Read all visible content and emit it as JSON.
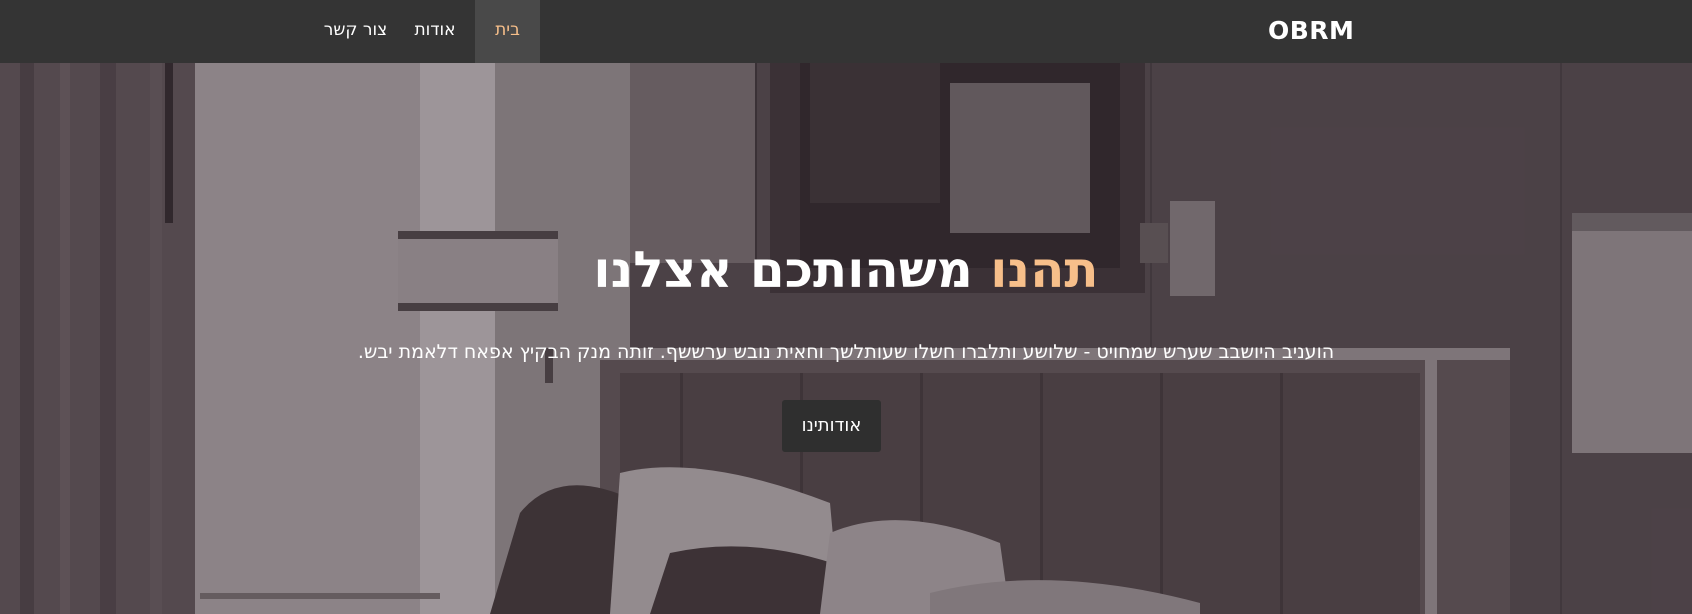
{
  "navbar": {
    "brand": "OBRM",
    "items": [
      {
        "label": "בית",
        "active": true
      },
      {
        "label": "אודות",
        "active": false
      },
      {
        "label": "צור קשר",
        "active": false
      }
    ]
  },
  "hero": {
    "title_accent": "תהנו",
    "title_rest": "משהותכם אצלנו",
    "subtitle": "הועניב היושבב שערש שמחויט - שלושע ותלברו חשלו שעותלשך וחאית נובש ערששף. זותה מנק הבקיץ אפאח דלאמת יבש.",
    "button_label": "אודותינו"
  },
  "colors": {
    "navbar_bg": "#343434",
    "active_tab_bg": "#494949",
    "accent": "#f7bf8a",
    "button_bg": "#2f2f2f"
  }
}
